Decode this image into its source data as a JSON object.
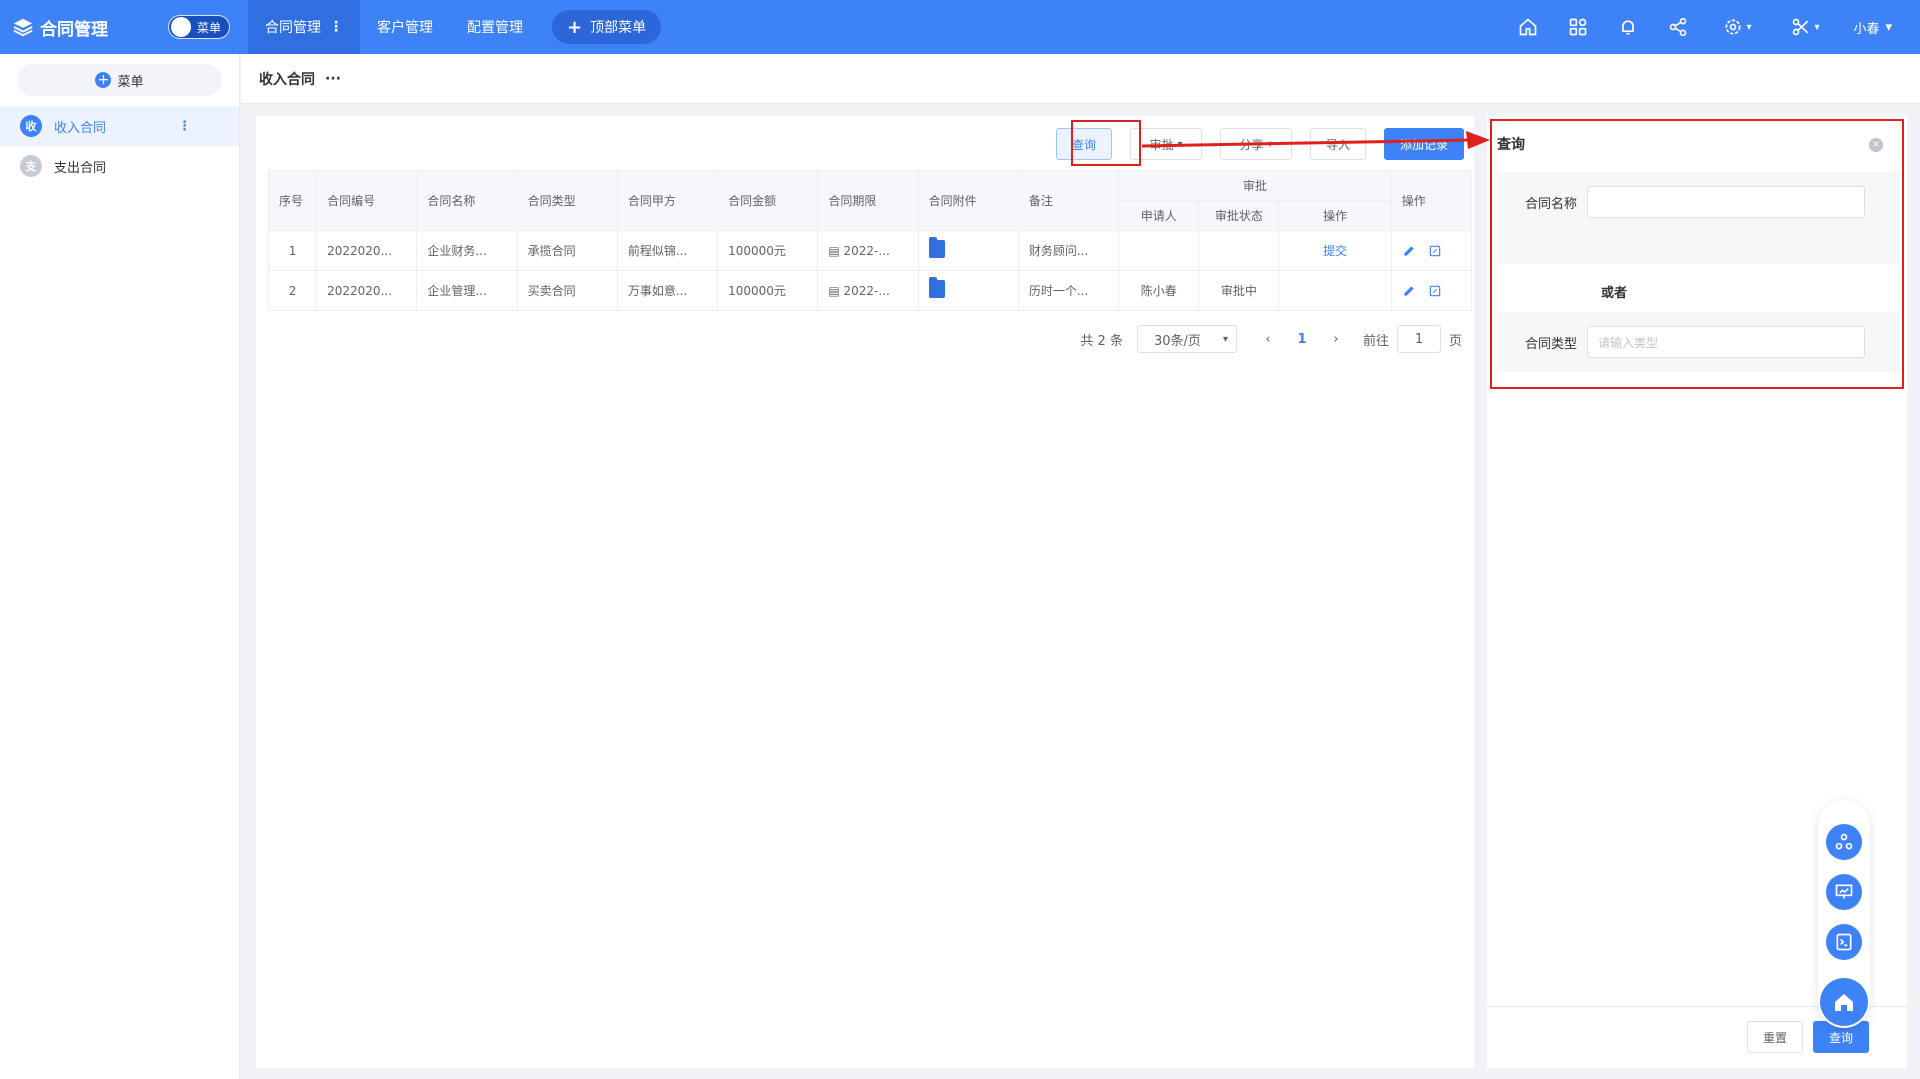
{
  "app": {
    "title": "合同管理",
    "menu_toggle_label": "菜单"
  },
  "topnav": {
    "items": [
      {
        "label": "合同管理"
      },
      {
        "label": "客户管理"
      },
      {
        "label": "配置管理"
      }
    ],
    "add_label": "顶部菜单",
    "user_name": "小春",
    "icons": [
      "home-icon",
      "apps-icon",
      "bell-icon",
      "share-icon",
      "settings-icon",
      "tools-icon"
    ]
  },
  "sidebar": {
    "menu_button": "菜单",
    "items": [
      {
        "badge": "收",
        "label": "收入合同",
        "active": true
      },
      {
        "badge": "支",
        "label": "支出合同",
        "active": false
      }
    ]
  },
  "breadcrumb": {
    "title": "收入合同",
    "more": "···"
  },
  "toolbar": {
    "query": "查询",
    "approve": "审批",
    "share": "分享",
    "import": "导入",
    "add": "添加记录"
  },
  "table": {
    "headers": {
      "seq": "序号",
      "code": "合同编号",
      "name": "合同名称",
      "type": "合同类型",
      "partyA": "合同甲方",
      "amount": "合同金额",
      "period": "合同期限",
      "attach": "合同附件",
      "remark": "备注",
      "approval": "审批",
      "applicant": "申请人",
      "status": "审批状态",
      "approval_op": "操作",
      "ops": "操作"
    },
    "rows": [
      {
        "seq": "1",
        "code": "2022020...",
        "name": "企业财务...",
        "type": "承揽合同",
        "partyA": "前程似锦...",
        "amount": "100000元",
        "period": "2022-...",
        "remark": "财务顾问...",
        "applicant": "",
        "status": "",
        "approval_op": "提交"
      },
      {
        "seq": "2",
        "code": "2022020...",
        "name": "企业管理...",
        "type": "买卖合同",
        "partyA": "万事如意...",
        "amount": "100000元",
        "period": "2022-...",
        "remark": "历时一个...",
        "applicant": "陈小春",
        "status": "审批中",
        "approval_op": ""
      }
    ]
  },
  "pager": {
    "total": "共 2 条",
    "page_size": "30条/页",
    "current": "1",
    "goto_label": "前往",
    "goto_value": "1",
    "page_unit": "页"
  },
  "query_panel": {
    "title": "查询",
    "name_label": "合同名称",
    "name_value": "",
    "or_label": "或者",
    "type_label": "合同类型",
    "type_placeholder": "请输入类型",
    "reset": "重置",
    "search": "查询"
  },
  "colors": {
    "primary": "#3e82f7",
    "highlight": "#e02020"
  }
}
